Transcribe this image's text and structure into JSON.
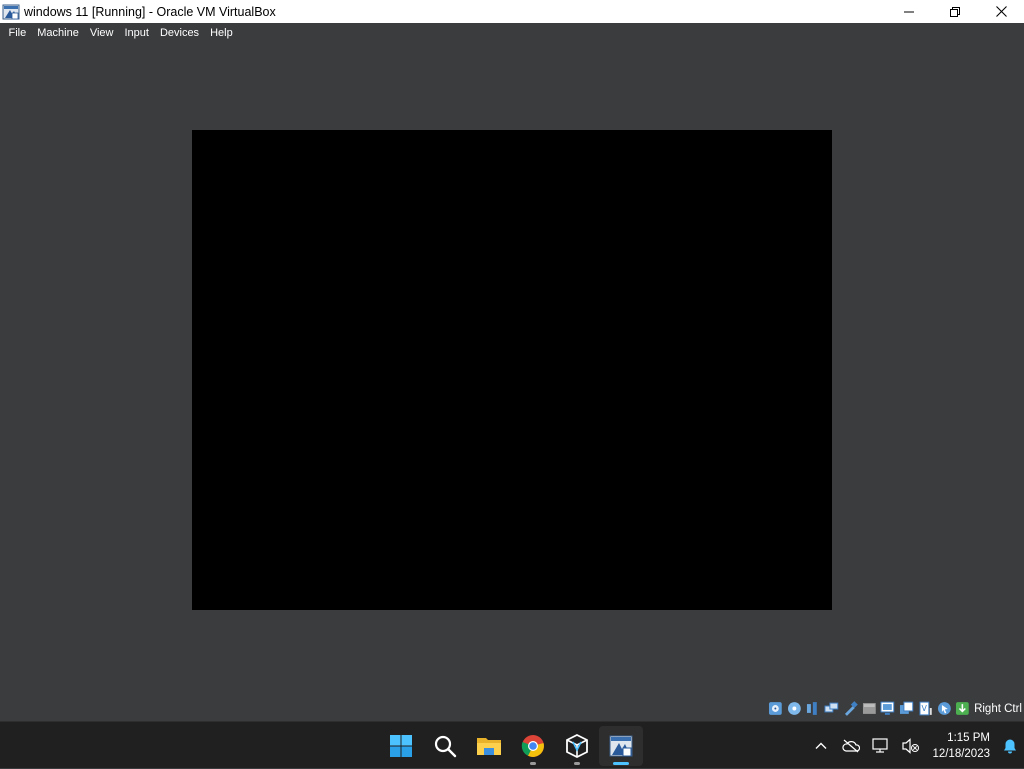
{
  "window": {
    "title": "windows 11 [Running] - Oracle VM VirtualBox",
    "app_icon": "virtualbox-icon",
    "controls": [
      "minimize-icon",
      "maximize-icon",
      "close-icon"
    ]
  },
  "menu": {
    "items": [
      {
        "label": "File"
      },
      {
        "label": "Machine"
      },
      {
        "label": "View"
      },
      {
        "label": "Input"
      },
      {
        "label": "Devices"
      },
      {
        "label": "Help"
      }
    ]
  },
  "vm": {
    "screen_state": "blank",
    "screen_color": "#000000"
  },
  "statusbar": {
    "icons": [
      "hard-disk-icon",
      "optical-drive-icon",
      "audio-icon",
      "network-icon",
      "usb-icon",
      "shared-folders-icon",
      "display-icon",
      "recording-icon",
      "cpu-icon",
      "mouse-integration-icon",
      "host-key-icon"
    ],
    "host_key": "Right Ctrl"
  },
  "taskbar": {
    "apps": [
      {
        "name": "start-icon",
        "running": false,
        "active": false
      },
      {
        "name": "search-icon",
        "running": false,
        "active": false
      },
      {
        "name": "file-explorer-icon",
        "running": false,
        "active": false
      },
      {
        "name": "chrome-icon",
        "running": true,
        "active": false
      },
      {
        "name": "virtualbox-manager-icon",
        "running": true,
        "active": false
      },
      {
        "name": "virtualbox-vm-icon",
        "running": true,
        "active": true
      }
    ],
    "tray": {
      "icons": [
        "chevron-up-icon",
        "onedrive-icon",
        "network-icon",
        "volume-muted-icon"
      ],
      "time": "1:15 PM",
      "date": "12/18/2023",
      "notification_icon": "bell-icon"
    }
  },
  "colors": {
    "vm_background": "#3b3c3e",
    "taskbar": "#202020",
    "accent": "#4cc2ff"
  }
}
